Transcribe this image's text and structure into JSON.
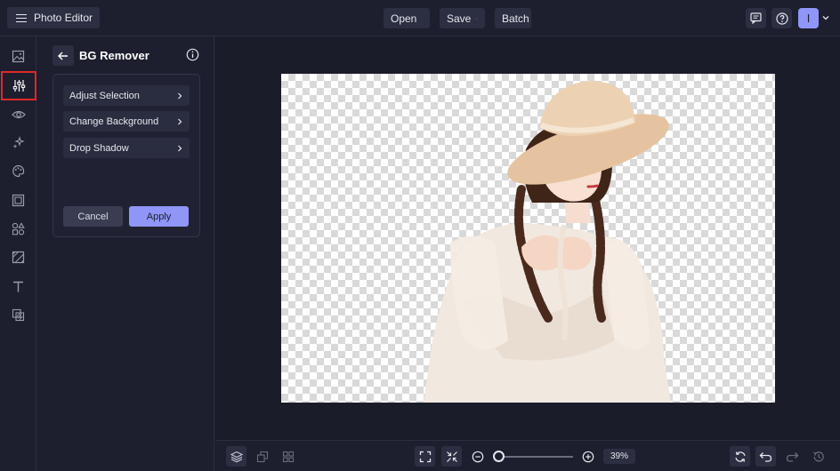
{
  "header": {
    "app_title": "Photo Editor",
    "menus": [
      {
        "label": "Open"
      },
      {
        "label": "Save"
      },
      {
        "label": "Batch"
      }
    ],
    "avatar_initial": "I"
  },
  "rail": {
    "items": [
      {
        "icon": "image-icon"
      },
      {
        "icon": "adjustments-sliders-icon",
        "active": true
      },
      {
        "icon": "eye-icon"
      },
      {
        "icon": "sparkle-effects-icon"
      },
      {
        "icon": "palette-icon"
      },
      {
        "icon": "frame-icon"
      },
      {
        "icon": "shapes-icon"
      },
      {
        "icon": "texture-icon"
      },
      {
        "icon": "text-icon"
      },
      {
        "icon": "overlay-icon"
      }
    ]
  },
  "panel": {
    "title": "BG Remover",
    "options": [
      {
        "label": "Adjust Selection"
      },
      {
        "label": "Change Background"
      },
      {
        "label": "Drop Shadow"
      }
    ],
    "cancel_label": "Cancel",
    "apply_label": "Apply"
  },
  "bottom": {
    "zoom_value": "39%"
  },
  "colors": {
    "accent": "#8f96f8",
    "background": "#1d1f2e",
    "active_outline": "#e12828"
  }
}
